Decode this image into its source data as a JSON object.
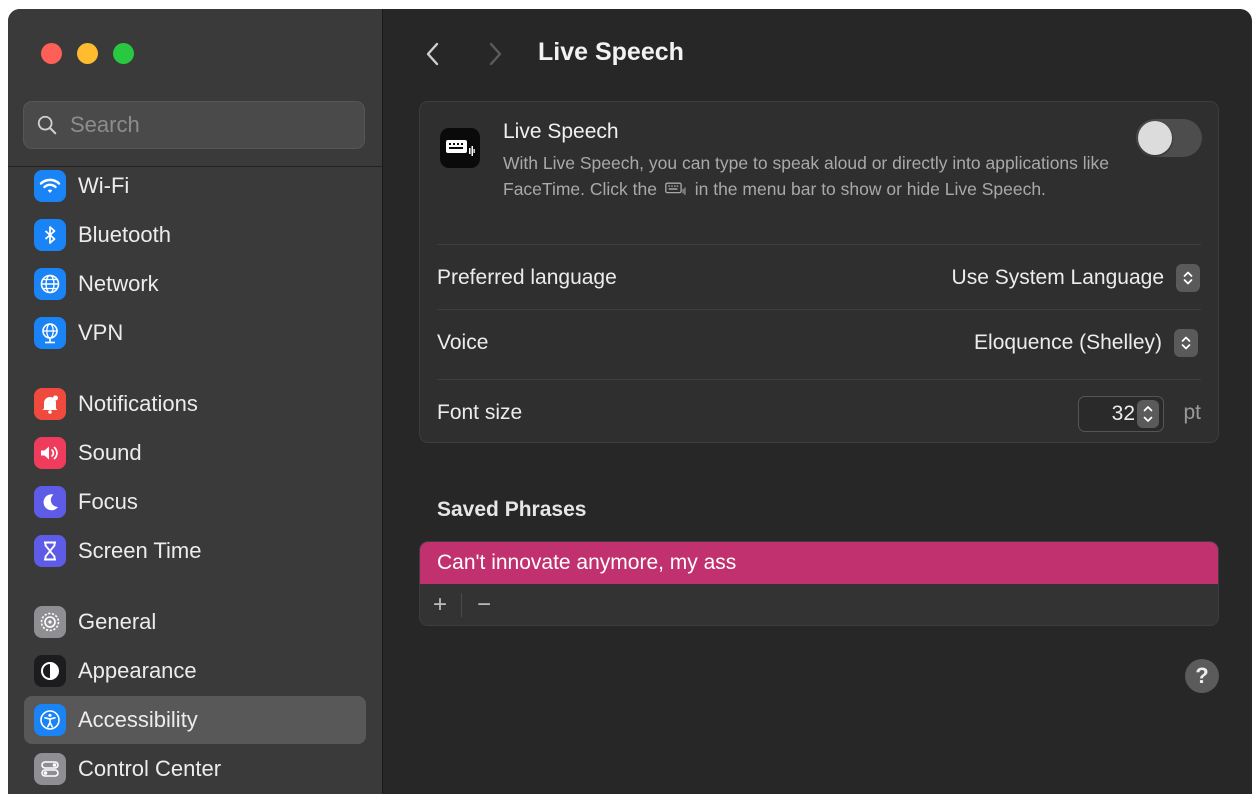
{
  "window": {
    "traffic_lights": {
      "close": "#fe5f57",
      "minimize": "#febc2e",
      "zoom": "#28c840"
    }
  },
  "sidebar": {
    "search": {
      "placeholder": "Search",
      "value": ""
    },
    "items": [
      {
        "label": "Wi-Fi",
        "icon": "wifi-icon",
        "color": "#1a83f5"
      },
      {
        "label": "Bluetooth",
        "icon": "bluetooth-icon",
        "color": "#1a83f5"
      },
      {
        "label": "Network",
        "icon": "globe-icon",
        "color": "#1a83f5"
      },
      {
        "label": "VPN",
        "icon": "vpn-globe-icon",
        "color": "#1a83f5"
      },
      {
        "label": "Notifications",
        "icon": "bell-icon",
        "color": "#f04a3f"
      },
      {
        "label": "Sound",
        "icon": "speaker-icon",
        "color": "#ef3b5c"
      },
      {
        "label": "Focus",
        "icon": "moon-icon",
        "color": "#5e5ce6"
      },
      {
        "label": "Screen Time",
        "icon": "hourglass-icon",
        "color": "#5e5ce6"
      },
      {
        "label": "General",
        "icon": "gear-icon",
        "color": "#8e8e93"
      },
      {
        "label": "Appearance",
        "icon": "appearance-icon",
        "color": "#1c1c1e"
      },
      {
        "label": "Accessibility",
        "icon": "accessibility-icon",
        "color": "#1a83f5",
        "selected": true
      },
      {
        "label": "Control Center",
        "icon": "control-center-icon",
        "color": "#8e8e93"
      }
    ]
  },
  "main": {
    "title": "Live Speech",
    "live_speech": {
      "title": "Live Speech",
      "description_before_icon": "With Live Speech, you can type to speak aloud or directly into applications like FaceTime. Click the",
      "description_after_icon": "in the menu bar to show or hide Live Speech.",
      "enabled": false,
      "icon": "keyboard-speech-icon"
    },
    "preferred_language": {
      "label": "Preferred language",
      "value": "Use System Language"
    },
    "voice": {
      "label": "Voice",
      "value": "Eloquence (Shelley)"
    },
    "font_size": {
      "label": "Font size",
      "value": "32",
      "unit": "pt"
    },
    "saved_phrases": {
      "title": "Saved Phrases",
      "items": [
        "Can't innovate anymore, my ass"
      ],
      "add_label": "+",
      "remove_label": "−"
    },
    "help_label": "?",
    "accent_color": "#c1316f"
  }
}
